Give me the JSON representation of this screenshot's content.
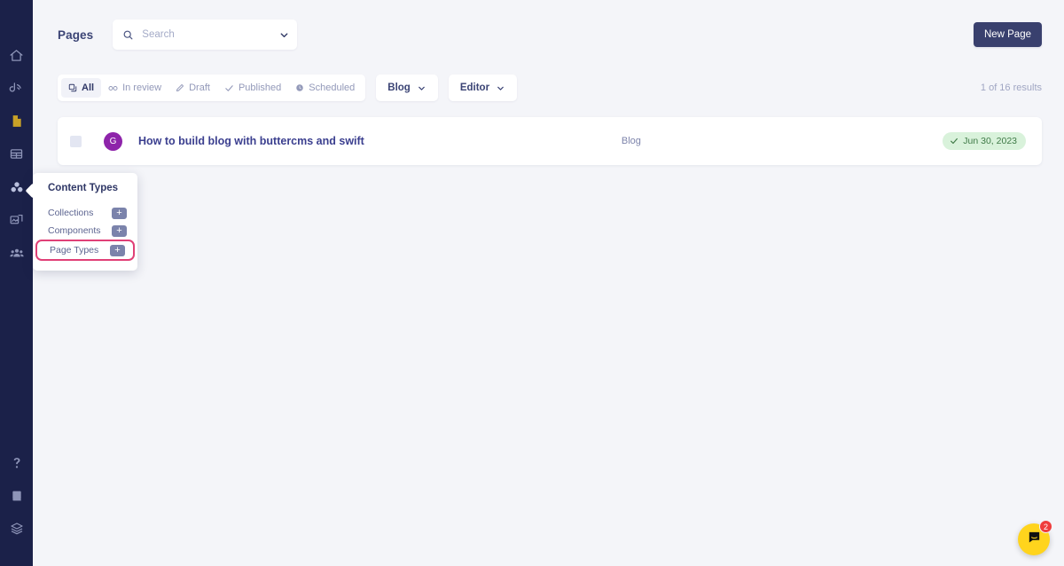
{
  "sidebar": {
    "top_items": [
      {
        "name": "home",
        "icon": "home-icon",
        "accent": false,
        "active": false
      },
      {
        "name": "blog",
        "icon": "blog-rss-icon",
        "accent": false,
        "active": false
      },
      {
        "name": "pages",
        "icon": "page-file-icon",
        "accent": true,
        "active": false
      },
      {
        "name": "collections",
        "icon": "table-grid-icon",
        "accent": false,
        "active": false
      },
      {
        "name": "content-types",
        "icon": "content-types-icon",
        "accent": false,
        "active": true
      },
      {
        "name": "media",
        "icon": "media-images-icon",
        "accent": false,
        "active": false
      },
      {
        "name": "team",
        "icon": "team-users-icon",
        "accent": false,
        "active": false
      }
    ],
    "bottom_items": [
      {
        "name": "help",
        "icon": "question-mark-icon",
        "accent": false,
        "active": false
      },
      {
        "name": "docs",
        "icon": "book-icon",
        "accent": false,
        "active": false
      },
      {
        "name": "layers",
        "icon": "layers-stack-icon",
        "accent": false,
        "active": false
      }
    ]
  },
  "header": {
    "title": "Pages",
    "search": {
      "value": "",
      "placeholder": "Search",
      "icon": "search-icon",
      "chevron": "chevron-down-icon"
    },
    "new_page_label": "New Page"
  },
  "filters": {
    "tabs": [
      {
        "label": "All",
        "icon": "copy-icon",
        "active": true
      },
      {
        "label": "In review",
        "icon": "binoculars-icon",
        "active": false
      },
      {
        "label": "Draft",
        "icon": "pencil-icon",
        "active": false
      },
      {
        "label": "Published",
        "icon": "check-icon",
        "active": false
      },
      {
        "label": "Scheduled",
        "icon": "clock-icon",
        "active": false
      }
    ],
    "dropdowns": [
      {
        "label": "Blog",
        "icon": "chevron-down-icon"
      },
      {
        "label": "Editor",
        "icon": "chevron-down-icon"
      }
    ],
    "results_text": "1 of 16 results"
  },
  "list": {
    "rows": [
      {
        "checked": false,
        "avatar_initial": "G",
        "avatar_color": "#8e24aa",
        "title": "How to build blog with buttercms and swift",
        "type": "Blog",
        "status_date": "Jun 30, 2023",
        "status_icon": "check-icon",
        "status_color": "#d9f2db"
      }
    ]
  },
  "popup": {
    "title": "Content Types",
    "items": [
      {
        "label": "Collections",
        "add_label": "+",
        "highlighted": false
      },
      {
        "label": "Components",
        "add_label": "+",
        "highlighted": false
      },
      {
        "label": "Page Types",
        "add_label": "+",
        "highlighted": true
      }
    ],
    "highlight_color": "#e04077"
  },
  "chat": {
    "icon": "chat-bubble-icon",
    "unread_count": "2",
    "button_color": "#ffd41d",
    "badge_color": "#ef3d3d"
  }
}
